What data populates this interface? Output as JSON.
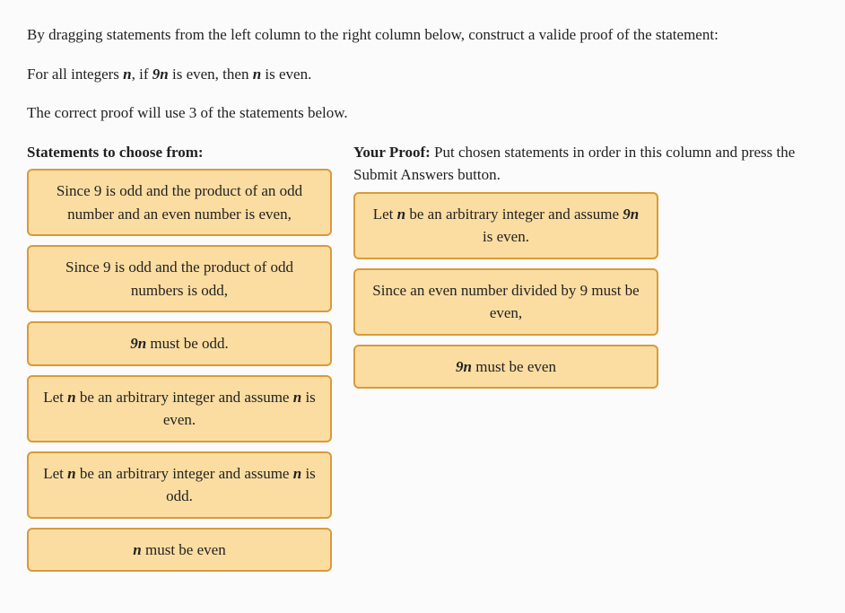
{
  "intro": {
    "line1_pre": "By dragging statements from the left column to the right column below, construct a valide proof of the statement:",
    "line2_html": "For all integers <span class=\"math-var\">n</span>, if <span class=\"math-expr\">9n</span> is even, then <span class=\"math-var\">n</span> is even.",
    "line3": "The correct proof will use 3 of the statements below."
  },
  "left": {
    "heading_strong": "Statements to choose from:",
    "items": [
      {
        "html": "Since 9 is odd and the product of an odd number and an even number is even,"
      },
      {
        "html": "Since 9 is odd and the product of odd numbers is odd,"
      },
      {
        "html": "<span class=\"math-expr\">9n</span> must be odd."
      },
      {
        "html": "Let <span class=\"math-var\">n</span> be an arbitrary integer and assume <span class=\"math-var\">n</span> is even."
      },
      {
        "html": "Let <span class=\"math-var\">n</span> be an arbitrary integer and assume <span class=\"math-var\">n</span> is odd."
      },
      {
        "html": "<span class=\"math-var\">n</span> must be even"
      }
    ]
  },
  "right": {
    "heading_strong": "Your Proof:",
    "heading_rest": " Put chosen statements in order in this column and press the Submit Answers button.",
    "items": [
      {
        "html": "Let <span class=\"math-var\">n</span> be an arbitrary integer and assume <span class=\"math-expr\">9n</span> is even."
      },
      {
        "html": "Since an even number divided by 9 must be even,"
      },
      {
        "html": "<span class=\"math-expr\">9n</span> must be even"
      }
    ]
  }
}
